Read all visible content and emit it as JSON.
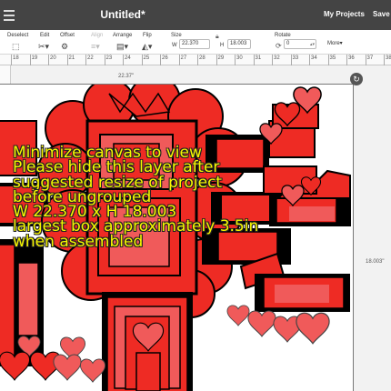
{
  "header": {
    "title": "Untitled*",
    "my_projects": "My Projects",
    "save": "Save"
  },
  "toolbar": {
    "deselect": "Deselect",
    "edit": "Edit",
    "offset": "Offset",
    "align": "Align",
    "arrange": "Arrange",
    "flip": "Flip",
    "size": "Size",
    "size_w_label": "W",
    "size_w_value": "22.370",
    "size_h_label": "H",
    "size_h_value": "18.003",
    "rotate": "Rotate",
    "rotate_value": "0",
    "more": "More"
  },
  "ruler": {
    "marks": [
      "18",
      "19",
      "20",
      "21",
      "22",
      "23",
      "24",
      "25",
      "26",
      "27",
      "28",
      "29",
      "30",
      "31",
      "32",
      "33",
      "34",
      "35",
      "36",
      "37",
      "38"
    ]
  },
  "dimensions": {
    "width": "22.37\"",
    "height": "18.003\""
  },
  "overlay_text": [
    "Minimize canvas to view",
    "Please hide this layer after",
    "suggested resize of project",
    "before ungrouped",
    "W 22.370 x H 18.003",
    "largest box approximately 3.5in",
    "when assembled"
  ],
  "colors": {
    "topbar": "#444444",
    "red": "#ee2b24",
    "pink": "#f05a5a",
    "overlay_text": "#f7f700"
  }
}
